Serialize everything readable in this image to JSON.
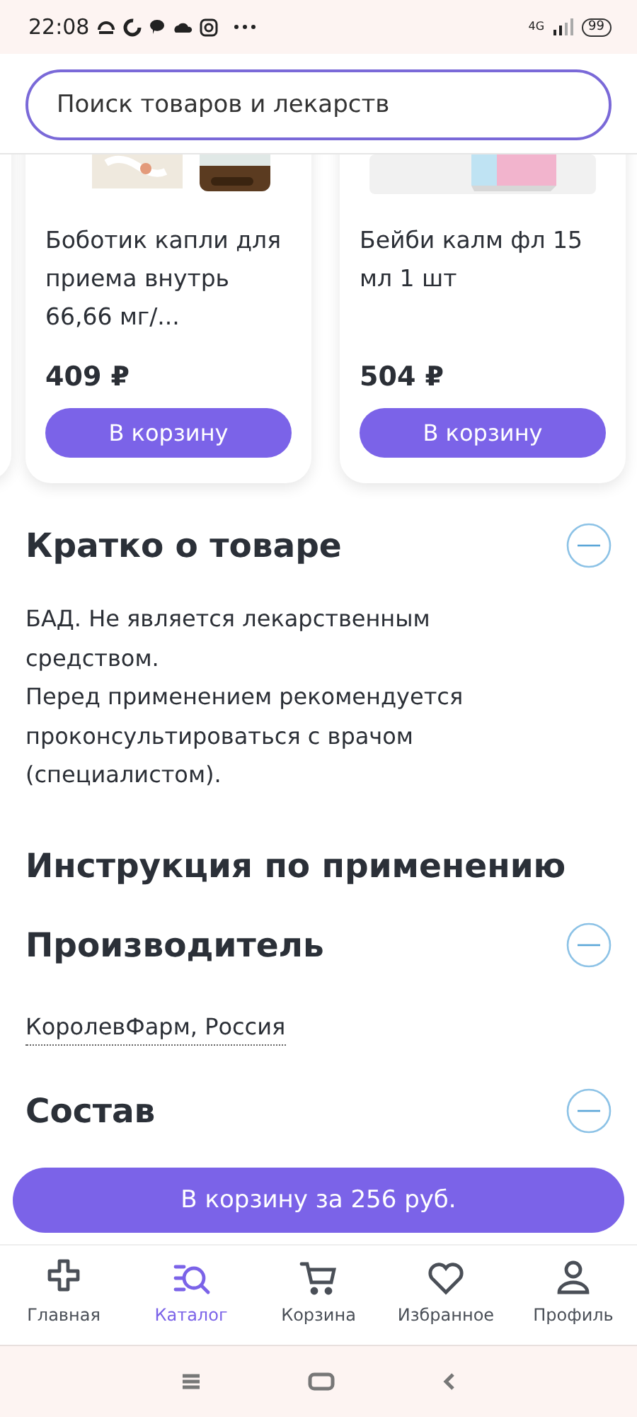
{
  "status_bar": {
    "time": "22:08",
    "network": "4G",
    "battery": "99"
  },
  "search": {
    "placeholder": "Поиск товаров и лекарств"
  },
  "products": [
    {
      "title": "Боботик капли для приема внутрь 66,66 мг/...",
      "price": "409 ₽",
      "button": "В корзину"
    },
    {
      "title": "Бейби калм фл 15 мл 1 шт",
      "price": "504 ₽",
      "button": "В корзину"
    }
  ],
  "sections": [
    {
      "kind": "toggle",
      "title": "Кратко о товаре",
      "expanded": true,
      "paragraphs": [
        "БАД. Не является лекарственным средством.",
        "Перед применением рекомендуется проконсультироваться с врачом (специалистом)."
      ]
    },
    {
      "kind": "plain",
      "title": "Инструкция по применению"
    },
    {
      "kind": "toggle",
      "title": "Производитель",
      "expanded": true,
      "link": "КоролевФарм, Россия"
    },
    {
      "kind": "toggle",
      "title": "Состав",
      "expanded": true
    }
  ],
  "cart_button": "В корзину за 256 руб.",
  "tabs": [
    {
      "label": "Главная",
      "selected": false
    },
    {
      "label": "Каталог",
      "selected": true
    },
    {
      "label": "Корзина",
      "selected": false
    },
    {
      "label": "Избранное",
      "selected": false
    },
    {
      "label": "Профиль",
      "selected": false
    }
  ]
}
